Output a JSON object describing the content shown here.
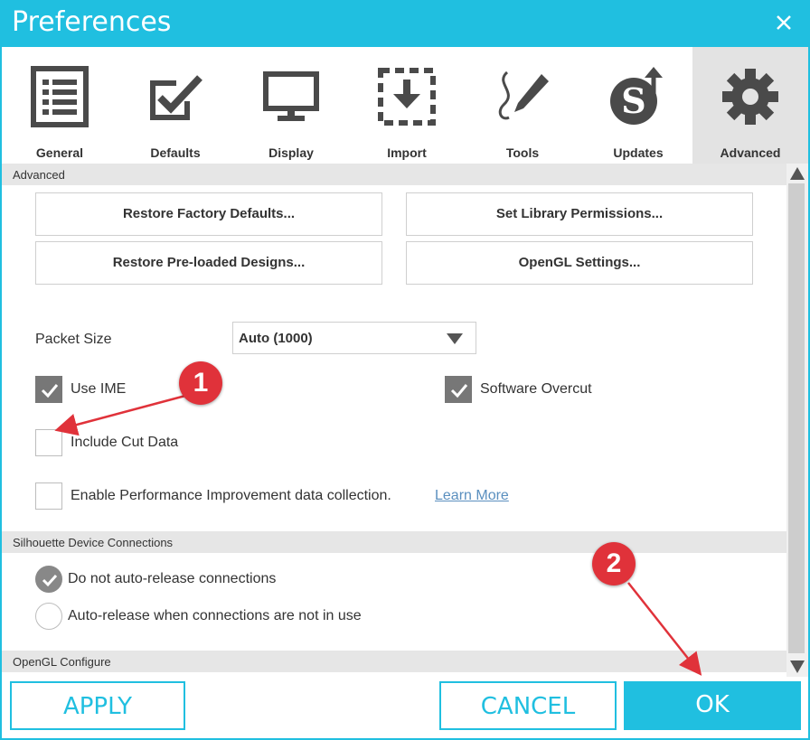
{
  "window": {
    "title": "Preferences"
  },
  "tabs": [
    {
      "label": "General",
      "icon": "list-document-icon"
    },
    {
      "label": "Defaults",
      "icon": "checkbox-edit-icon"
    },
    {
      "label": "Display",
      "icon": "monitor-icon"
    },
    {
      "label": "Import",
      "icon": "import-icon"
    },
    {
      "label": "Tools",
      "icon": "pen-tool-icon"
    },
    {
      "label": "Updates",
      "icon": "silhouette-update-icon"
    },
    {
      "label": "Advanced",
      "icon": "gear-icon",
      "active": true
    }
  ],
  "advanced": {
    "header": "Advanced",
    "buttons": {
      "restore_factory": "Restore Factory Defaults...",
      "library_permissions": "Set Library Permissions...",
      "restore_designs": "Restore Pre-loaded Designs...",
      "opengl_settings": "OpenGL Settings..."
    },
    "packet_size": {
      "label": "Packet Size",
      "value": "Auto (1000)"
    },
    "use_ime": {
      "label": "Use IME",
      "checked": true
    },
    "software_overcut": {
      "label": "Software Overcut",
      "checked": true
    },
    "include_cut_data": {
      "label": "Include Cut Data",
      "checked": false
    },
    "performance": {
      "label": "Enable Performance Improvement data collection.",
      "link": "Learn More",
      "checked": false
    }
  },
  "device_connections": {
    "header": "Silhouette Device Connections",
    "options": [
      {
        "label": "Do not auto-release connections",
        "selected": true
      },
      {
        "label": "Auto-release when connections are not in use",
        "selected": false
      }
    ]
  },
  "opengl": {
    "header": "OpenGL Configure"
  },
  "footer": {
    "apply": "APPLY",
    "cancel": "CANCEL",
    "ok": "OK"
  },
  "annotations": [
    "1",
    "2"
  ],
  "colors": {
    "accent": "#20bfe0",
    "annotation": "#e0323a",
    "checked": "#777777"
  }
}
